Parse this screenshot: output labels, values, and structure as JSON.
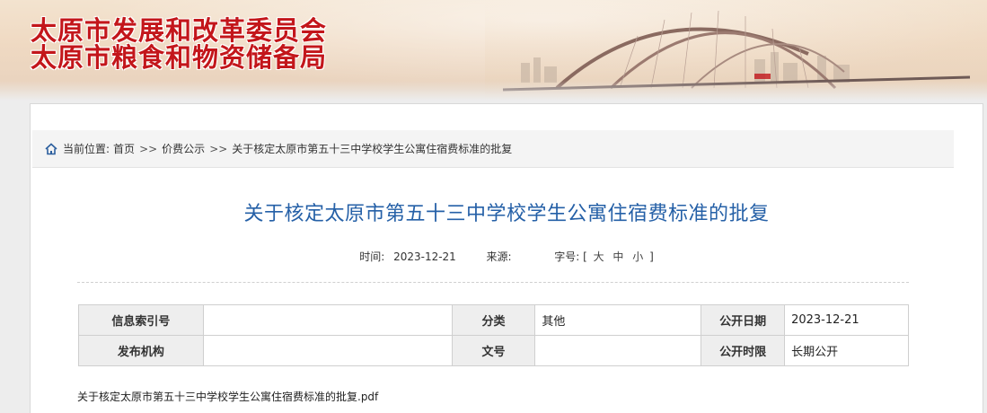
{
  "header": {
    "org_line_1": "太原市发展和改革委员会",
    "org_line_2": "太原市粮食和物资储备局"
  },
  "breadcrumb": {
    "prefix": "当前位置:",
    "items": [
      "首页",
      "价费公示",
      "关于核定太原市第五十三中学校学生公寓住宿费标准的批复"
    ],
    "separator": ">>"
  },
  "article": {
    "title": "关于核定太原市第五十三中学校学生公寓住宿费标准的批复",
    "time_label": "时间:",
    "time_value": "2023-12-21",
    "source_label": "来源:",
    "source_value": "",
    "font_size_label": "字号:",
    "font_size_open": "[",
    "font_size_close": "]",
    "font_sizes": [
      "大",
      "中",
      "小"
    ]
  },
  "info_table": {
    "row1": {
      "index_label": "信息索引号",
      "index_value": "",
      "category_label": "分类",
      "category_value": "其他",
      "date_label": "公开日期",
      "date_value": "2023-12-21"
    },
    "row2": {
      "publisher_label": "发布机构",
      "publisher_value": "",
      "doc_no_label": "文号",
      "doc_no_value": "",
      "scope_label": "公开时限",
      "scope_value": "长期公开"
    }
  },
  "attachment": {
    "filename": "关于核定太原市第五十三中学校学生公寓住宿费标准的批复.pdf"
  },
  "colors": {
    "banner_red": "#c3161b",
    "title_blue": "#2560a7"
  },
  "icons": {
    "home": "home-icon"
  }
}
